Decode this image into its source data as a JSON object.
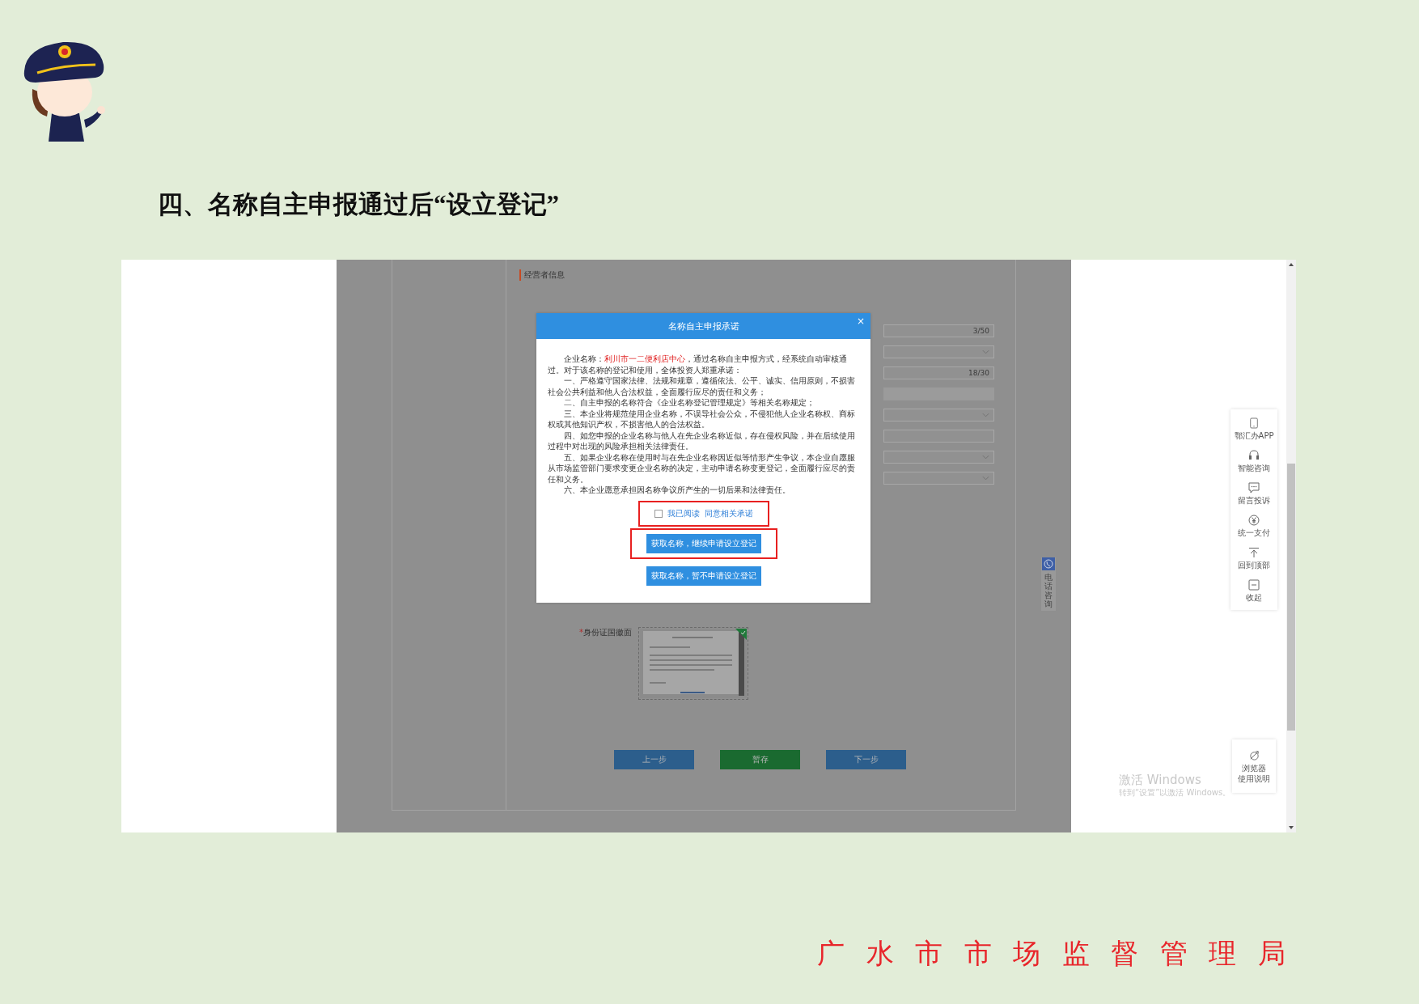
{
  "heading": "四、名称自主申报通过后“设立登记”",
  "screenshot": {
    "form": {
      "section_title": "经营者信息",
      "fields": [
        {
          "kind": "text",
          "counter": "3/50"
        },
        {
          "kind": "select"
        },
        {
          "kind": "text",
          "counter": "18/30"
        },
        {
          "kind": "readonly"
        },
        {
          "kind": "select"
        },
        {
          "kind": "text"
        },
        {
          "kind": "select"
        },
        {
          "kind": "select"
        }
      ],
      "upload": {
        "required_mark": "*",
        "label": "身份证国徽面",
        "kind": "picture"
      },
      "buttons": [
        {
          "label": "上一步",
          "kind": "nav"
        },
        {
          "label": "暂存",
          "kind": "save"
        },
        {
          "label": "下一步",
          "kind": "nav"
        }
      ]
    },
    "phone_tab": {
      "label": "电话咨询"
    },
    "dialog": {
      "title": "名称自主申报承诺",
      "close": "×",
      "intro": {
        "label": "企业名称：",
        "name": "利川市一二便利店中心",
        "rest": "，通过名称自主申报方式，经系统自动审核通过。对于该名称的登记和使用，全体投资人郑重承诺："
      },
      "clauses": [
        "一、严格遵守国家法律、法规和规章，遵循依法、公平、诚实、信用原则，不损害社会公共利益和他人合法权益，全面履行应尽的责任和义务；",
        "二、自主申报的名称符合《企业名称登记管理规定》等相关名称规定；",
        "三、本企业将规范使用企业名称，不误导社会公众，不侵犯他人企业名称权、商标权或其他知识产权，不损害他人的合法权益。",
        "四、如您申报的企业名称与他人在先企业名称近似，存在侵权风险，并在后续使用过程中对出现的风险承担相关法律责任。",
        "五、如果企业名称在使用时与在先企业名称因近似等情形产生争议，本企业自愿服从市场监管部门要求变更企业名称的决定，主动申请名称变更登记，全面履行应尽的责任和义务。",
        "六、本企业愿意承担因名称争议所产生的一切后果和法律责任。"
      ],
      "agree": {
        "checked": false,
        "label": "我已阅读",
        "link": "同意相关承诺",
        "highlighted": true
      },
      "actions": [
        {
          "label": "获取名称，继续申请设立登记",
          "highlighted": true
        },
        {
          "label": "获取名称，暂不申请设立登记",
          "highlighted": false
        }
      ]
    },
    "sidebar": {
      "items": [
        {
          "label": "鄂汇办APP"
        },
        {
          "label": "智能咨询"
        },
        {
          "label": "留言投诉"
        },
        {
          "label": "统一支付"
        },
        {
          "label": "回到顶部"
        },
        {
          "label": "收起"
        }
      ]
    },
    "browser_tips": {
      "lines": [
        "浏览器",
        "使用说明"
      ]
    },
    "activation_notice": {
      "title": "激活 Windows",
      "hint": "转到“设置”以激活 Windows。"
    }
  },
  "footer": "广 水 市 市 场 监 督 管 理 局"
}
